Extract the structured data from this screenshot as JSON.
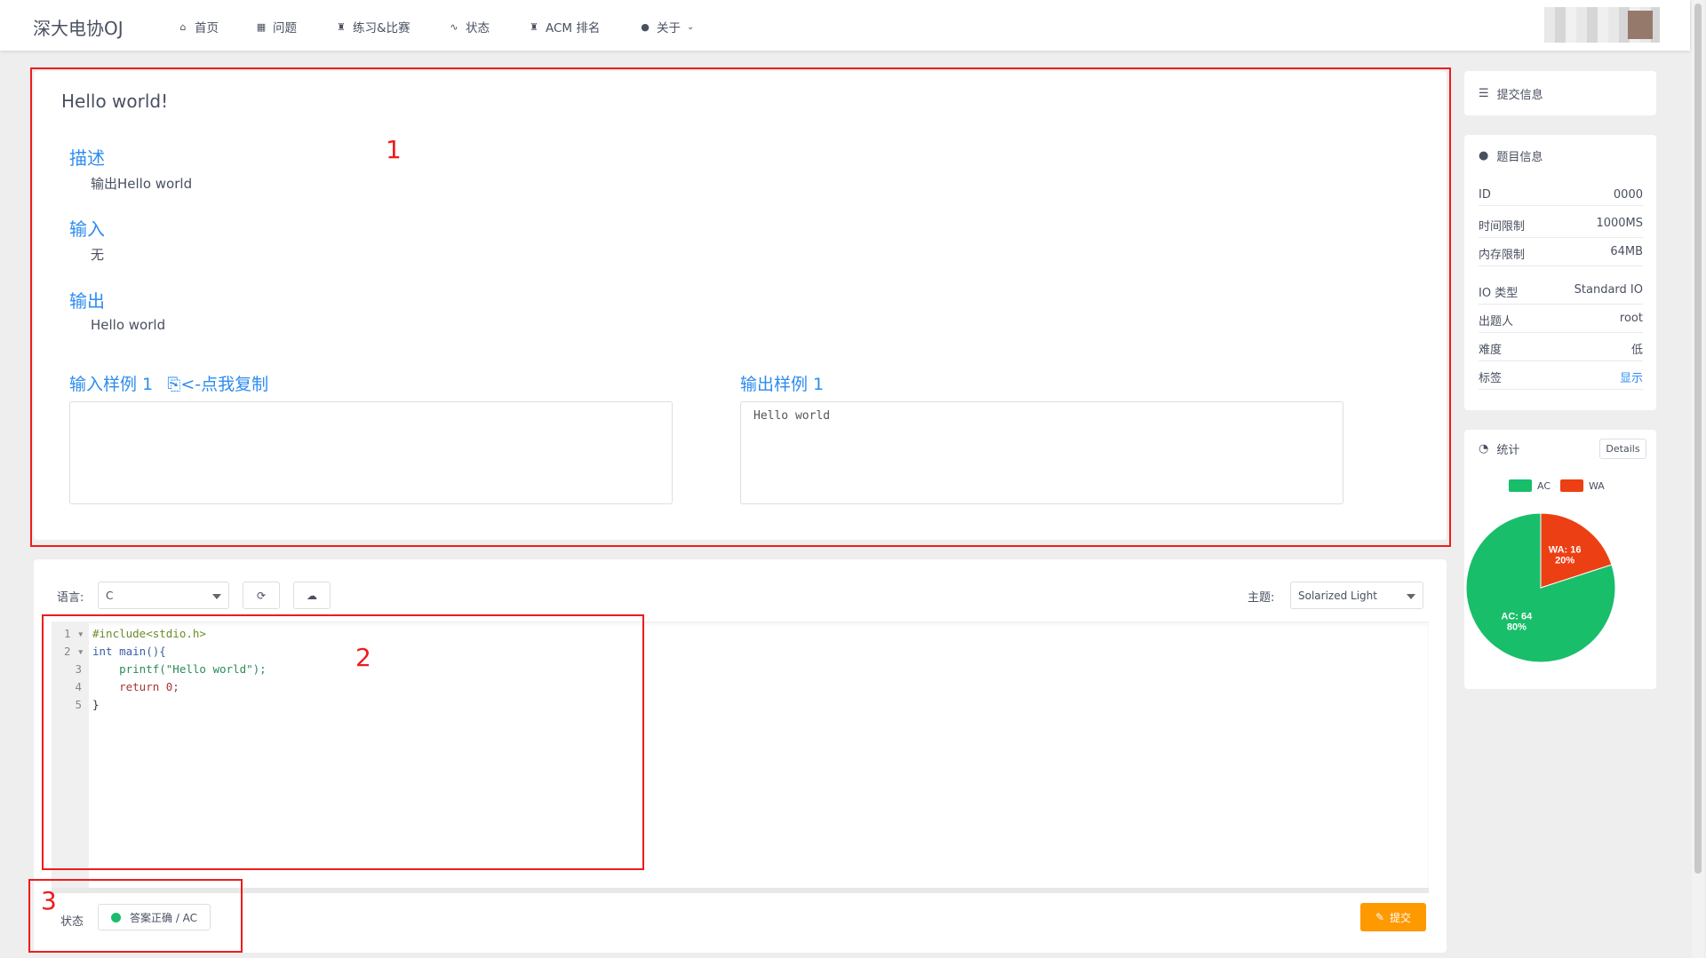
{
  "nav": {
    "brand": "深大电协OJ",
    "items": [
      {
        "label": "首页",
        "icon": "home-icon",
        "glyph": "⌂"
      },
      {
        "label": "问题",
        "icon": "grid-icon",
        "glyph": "▦"
      },
      {
        "label": "练习&比赛",
        "icon": "trophy-icon",
        "glyph": "🏆"
      },
      {
        "label": "状态",
        "icon": "pulse-icon",
        "glyph": "∿"
      },
      {
        "label": "ACM 排名",
        "icon": "trophy-icon",
        "glyph": "🏆"
      },
      {
        "label": "关于",
        "icon": "info-icon",
        "glyph": "ℹ"
      }
    ]
  },
  "annotations": {
    "one": "1",
    "two": "2",
    "three": "3"
  },
  "problem": {
    "title": "Hello world!",
    "description_label": "描述",
    "description": "输出Hello world",
    "input_label": "输入",
    "input": "无",
    "output_label": "输出",
    "output": "Hello world",
    "sample_input_label": "输入样例 1",
    "copy_hint": "<-点我复制",
    "sample_input": "",
    "sample_output_label": "输出样例 1",
    "sample_output": "Hello world"
  },
  "editor": {
    "language_label": "语言:",
    "language": "C",
    "theme_label": "主题:",
    "theme": "Solarized Light",
    "code_lines": [
      "#include<stdio.h>",
      "int main(){",
      "    printf(\"Hello world\");",
      "    return 0;",
      "}"
    ]
  },
  "status": {
    "label": "状态",
    "result": "答案正确 / AC",
    "submit_label": "提交"
  },
  "sidebar": {
    "submission_title": "提交信息",
    "info_title": "题目信息",
    "rows": [
      {
        "k": "ID",
        "v": "0000"
      },
      {
        "k": "时间限制",
        "v": "1000MS"
      },
      {
        "k": "内存限制",
        "v": "64MB"
      },
      {
        "k": "IO 类型",
        "v": "Standard IO"
      },
      {
        "k": "出题人",
        "v": "root"
      },
      {
        "k": "难度",
        "v": "低"
      },
      {
        "k": "标签",
        "v": "显示"
      }
    ],
    "stats_title": "统计",
    "details_label": "Details"
  },
  "chart_data": {
    "type": "pie",
    "categories": [
      "AC",
      "WA"
    ],
    "values": [
      64,
      16
    ],
    "percents": [
      "80%",
      "20%"
    ],
    "colors": [
      "#19be6b",
      "#ed3f14"
    ],
    "slice_labels": [
      "AC: 64",
      "WA: 16"
    ],
    "legend": "top"
  }
}
